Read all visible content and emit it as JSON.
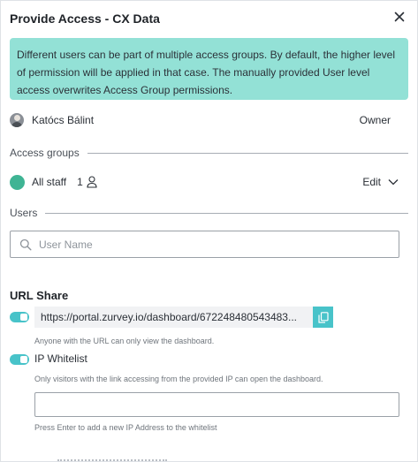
{
  "dialog": {
    "title": "Provide Access - CX Data",
    "close_icon": "close-icon"
  },
  "info_banner": {
    "text": "Different users can be part of multiple access groups. By default, the higher level of permission will be applied in that case. The manually provided User level access overwrites Access Group permissions.",
    "color": "#93e1d6"
  },
  "owner": {
    "name": "Katócs Bálint",
    "role": "Owner"
  },
  "access_groups": {
    "label": "Access groups",
    "items": [
      {
        "name": "All staff",
        "member_count": "1",
        "color": "#3fb494",
        "action": "Edit"
      }
    ]
  },
  "users": {
    "label": "Users",
    "search_placeholder": "User Name"
  },
  "url_share": {
    "title": "URL Share",
    "enabled": true,
    "url": "https://portal.zurvey.io/dashboard/672248480543483...",
    "url_hint": "Anyone with the URL can only view the dashboard.",
    "accent_color": "#48c3c9"
  },
  "ip_whitelist": {
    "label": "IP Whitelist",
    "enabled": true,
    "hint": "Only visitors with the link accessing from the provided IP can open the dashboard.",
    "input_value": "",
    "input_hint": "Press Enter to add a new IP Address to the whitelist"
  }
}
